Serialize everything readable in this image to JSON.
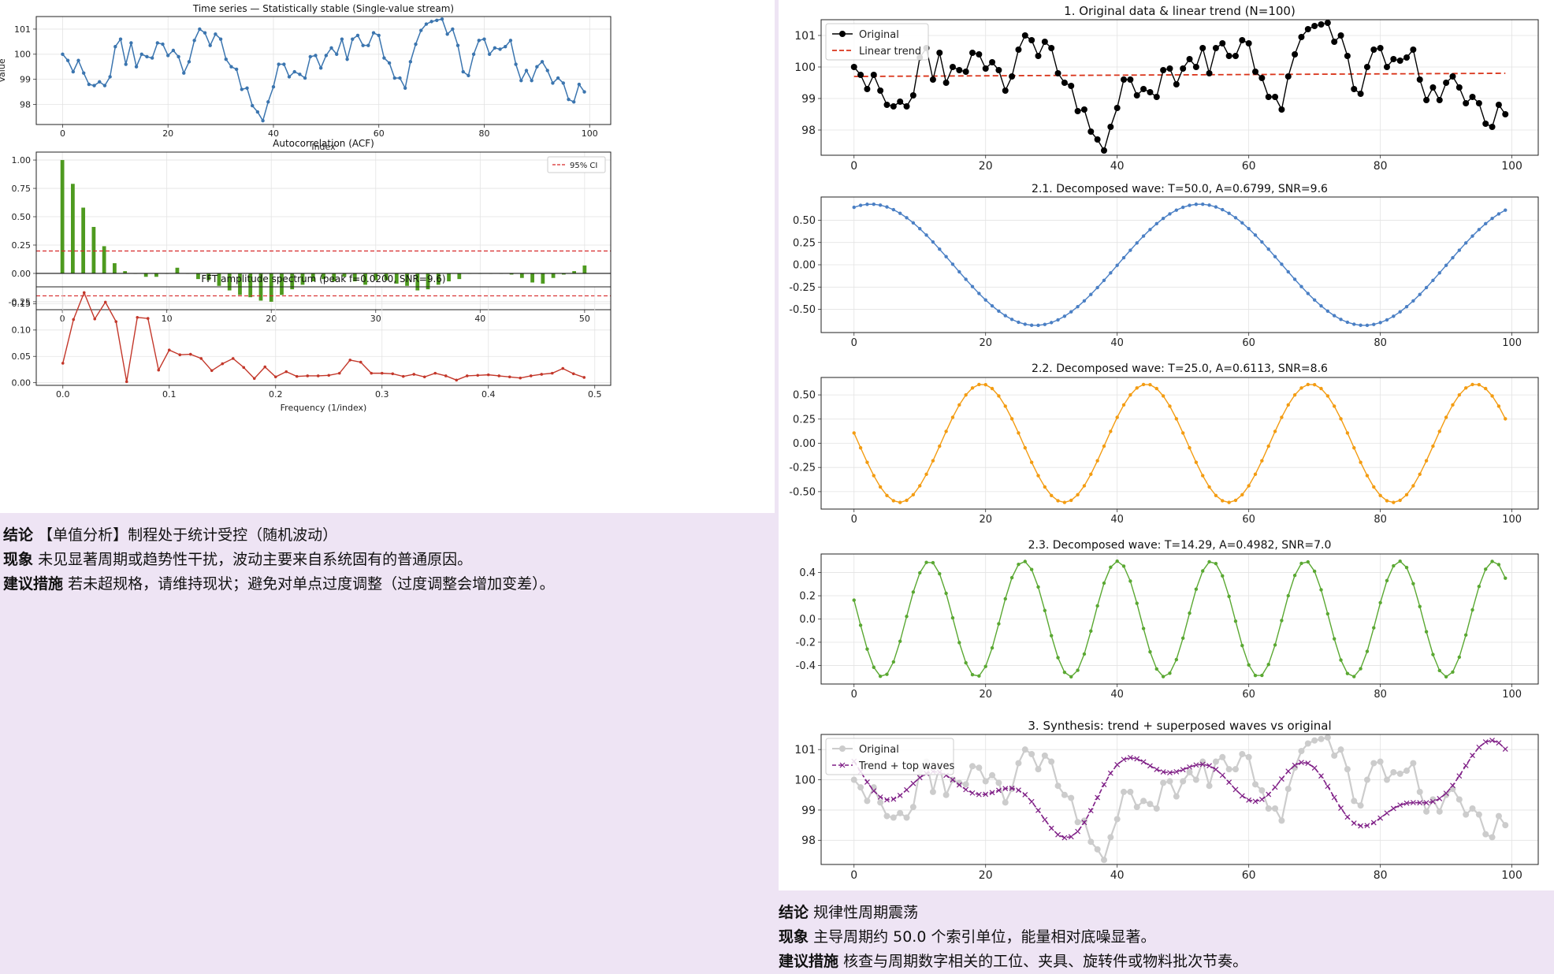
{
  "left_conclusion": {
    "conclusion_label": "结论",
    "conclusion_text": "【单值分析】制程处于统计受控（随机波动）",
    "phenomenon_label": "现象",
    "phenomenon_text": "未见显著周期或趋势性干扰，波动主要来自系统固有的普通原因。",
    "action_label": "建议措施",
    "action_text": "若未超规格，请维持现状；避免对单点过度调整（过度调整会增加变差）。"
  },
  "right_conclusion": {
    "conclusion_label": "结论",
    "conclusion_text": "规律性周期震荡",
    "phenomenon_label": "现象",
    "phenomenon_text": "主导周期约 50.0 个索引单位，能量相对底噪显著。",
    "action_label": "建议措施",
    "action_text": "核查与周期数字相关的工位、夹具、旋转件或物料批次节奏。"
  },
  "colors": {
    "series_blue": "#3b75af",
    "acf_green": "#4e9a1f",
    "fft_red": "#c3372a",
    "ci_red": "#d62728",
    "wave1_blue": "#4a7fc4",
    "wave2_orange": "#f39c12",
    "wave3_green": "#5aa832",
    "original_black": "#000000",
    "trend_red": "#d9341a",
    "synthesis_purple": "#7f1f86",
    "original_gray": "#cccccc",
    "background_lilac": "#eee4f4"
  },
  "chart_data": [
    {
      "id": "ts",
      "type": "line",
      "title": "Time series — Statistically stable (Single-value stream)",
      "xlabel": "Index",
      "ylabel": "Value",
      "xlim": [
        -5,
        104
      ],
      "ylim": [
        97.2,
        101.5
      ],
      "xticks": [
        0,
        20,
        40,
        60,
        80,
        100
      ],
      "yticks": [
        98,
        99,
        100,
        101
      ],
      "grid": true,
      "series": [
        {
          "color": "#3b75af",
          "x_start": 0,
          "y": [
            100.0,
            99.75,
            99.3,
            99.75,
            99.25,
            98.8,
            98.75,
            98.9,
            98.75,
            99.1,
            100.3,
            100.6,
            99.6,
            100.45,
            99.5,
            100.0,
            99.9,
            99.85,
            100.45,
            100.4,
            99.95,
            100.15,
            99.9,
            99.25,
            99.7,
            100.55,
            101.0,
            100.85,
            100.35,
            100.8,
            100.6,
            99.8,
            99.5,
            99.4,
            98.6,
            98.65,
            97.95,
            97.7,
            97.35,
            98.1,
            98.7,
            99.6,
            99.6,
            99.1,
            99.3,
            99.2,
            99.05,
            99.9,
            99.95,
            99.45,
            99.95,
            100.25,
            100.0,
            100.6,
            99.8,
            100.6,
            100.75,
            100.35,
            100.35,
            100.85,
            100.75,
            99.85,
            99.65,
            99.05,
            99.05,
            98.65,
            99.7,
            100.4,
            100.95,
            101.2,
            101.3,
            101.35,
            101.4,
            100.8,
            101.0,
            100.35,
            99.3,
            99.15,
            100.0,
            100.55,
            100.6,
            100.0,
            100.25,
            100.2,
            100.3,
            100.55,
            99.6,
            98.95,
            99.35,
            98.95,
            99.5,
            99.7,
            99.35,
            98.85,
            99.05,
            98.85,
            98.2,
            98.1,
            98.8,
            98.5
          ]
        }
      ]
    },
    {
      "id": "acf",
      "type": "bar",
      "title": "Autocorrelation (ACF)",
      "xlim": [
        -2.5,
        52.5
      ],
      "ylim": [
        -0.32,
        1.07
      ],
      "xticks": [
        0,
        10,
        20,
        30,
        40,
        50
      ],
      "yticks": [
        -0.25,
        0.0,
        0.25,
        0.5,
        0.75,
        1.0
      ],
      "legend": "top-right",
      "ci": 0.198,
      "ci_label": "95% CI",
      "lags": [
        0,
        1,
        2,
        3,
        4,
        5,
        6,
        7,
        8,
        9,
        10,
        11,
        12,
        13,
        14,
        15,
        16,
        17,
        18,
        19,
        20,
        21,
        22,
        23,
        24,
        25,
        26,
        27,
        28,
        29,
        30,
        31,
        32,
        33,
        34,
        35,
        36,
        37,
        38,
        39,
        40,
        41,
        42,
        43,
        44,
        45,
        46,
        47,
        48,
        49,
        50
      ],
      "values": [
        1.0,
        0.79,
        0.58,
        0.41,
        0.24,
        0.09,
        0.02,
        0.0,
        -0.03,
        -0.03,
        0.0,
        0.05,
        0.0,
        -0.05,
        -0.06,
        -0.11,
        -0.15,
        -0.19,
        -0.21,
        -0.24,
        -0.25,
        -0.19,
        -0.14,
        -0.1,
        -0.07,
        -0.05,
        -0.07,
        -0.03,
        -0.07,
        -0.1,
        -0.06,
        -0.06,
        -0.09,
        -0.11,
        -0.15,
        -0.14,
        -0.1,
        -0.07,
        -0.05,
        0.0,
        0.0,
        0.0,
        0.0,
        -0.01,
        -0.04,
        -0.08,
        -0.09,
        -0.04,
        -0.01,
        0.02,
        0.07
      ]
    },
    {
      "id": "fft",
      "type": "line",
      "title": "FFT amplitude spectrum (peak f=0.0200, SNR=9.6)",
      "xlabel": "Frequency (1/index)",
      "xlim": [
        -0.025,
        0.515
      ],
      "ylim": [
        -0.005,
        0.182
      ],
      "xticks": [
        0.0,
        0.1,
        0.2,
        0.3,
        0.4,
        0.5
      ],
      "yticks": [
        0.0,
        0.05,
        0.1,
        0.15
      ],
      "x_step": 0.01,
      "values": [
        0.037,
        0.12,
        0.171,
        0.121,
        0.153,
        0.116,
        0.002,
        0.124,
        0.122,
        0.024,
        0.062,
        0.053,
        0.054,
        0.046,
        0.023,
        0.036,
        0.046,
        0.029,
        0.008,
        0.03,
        0.011,
        0.021,
        0.012,
        0.013,
        0.013,
        0.014,
        0.018,
        0.043,
        0.039,
        0.018,
        0.018,
        0.017,
        0.012,
        0.016,
        0.011,
        0.018,
        0.013,
        0.005,
        0.013,
        0.014,
        0.015,
        0.013,
        0.011,
        0.009,
        0.013,
        0.016,
        0.018,
        0.027,
        0.017,
        0.01
      ]
    },
    {
      "id": "orig",
      "type": "line",
      "title": "1. Original data & linear trend (N=100)",
      "xlim": [
        -5,
        104
      ],
      "ylim": [
        97.2,
        101.5
      ],
      "xticks": [
        0,
        20,
        40,
        60,
        80,
        100
      ],
      "yticks": [
        98,
        99,
        100,
        101
      ],
      "legend": "top-left",
      "series": [
        {
          "name": "Original",
          "color": "#000000",
          "style": "line-dot"
        },
        {
          "name": "Linear trend",
          "color": "#d9341a",
          "style": "dashed",
          "y_range": [
            99.7,
            99.8
          ]
        }
      ]
    },
    {
      "id": "w1",
      "type": "line",
      "title": "2.1. Decomposed wave: T=50.0, A=0.6799, SNR=9.6",
      "period": 50.0,
      "amplitude": 0.6799,
      "phase_deg": -18.5,
      "color": "#4a7fc4",
      "xlim": [
        -5,
        104
      ],
      "ylim": [
        -0.76,
        0.76
      ],
      "xticks": [
        0,
        20,
        40,
        60,
        80,
        100
      ],
      "yticks": [
        -0.5,
        -0.25,
        0.0,
        0.25,
        0.5
      ]
    },
    {
      "id": "w2",
      "type": "line",
      "title": "2.2. Decomposed wave: T=25.0, A=0.6113, SNR=8.6",
      "period": 25.0,
      "amplitude": 0.6113,
      "phase_deg": 80,
      "color": "#f39c12",
      "xlim": [
        -5,
        104
      ],
      "ylim": [
        -0.68,
        0.68
      ],
      "xticks": [
        0,
        20,
        40,
        60,
        80,
        100
      ],
      "yticks": [
        -0.5,
        -0.25,
        0.0,
        0.25,
        0.5
      ]
    },
    {
      "id": "w3",
      "type": "line",
      "title": "2.3. Decomposed wave: T=14.29, A=0.4982, SNR=7.0",
      "period": 14.29,
      "amplitude": 0.4982,
      "phase_deg": 71,
      "color": "#5aa832",
      "xlim": [
        -5,
        104
      ],
      "ylim": [
        -0.56,
        0.56
      ],
      "xticks": [
        0,
        20,
        40,
        60,
        80,
        100
      ],
      "yticks": [
        -0.4,
        -0.2,
        0.0,
        0.2,
        0.4
      ]
    },
    {
      "id": "synth",
      "type": "line",
      "title": "3. Synthesis: trend + superposed waves vs original",
      "xlim": [
        -5,
        104
      ],
      "ylim": [
        97.2,
        101.5
      ],
      "xticks": [
        0,
        20,
        40,
        60,
        80,
        100
      ],
      "yticks": [
        98,
        99,
        100,
        101
      ],
      "legend": "top-left",
      "series": [
        {
          "name": "Original",
          "color": "#cccccc",
          "style": "line-dot"
        },
        {
          "name": "Trend + top waves",
          "color": "#7f1f86",
          "style": "dashed-x"
        }
      ]
    }
  ]
}
